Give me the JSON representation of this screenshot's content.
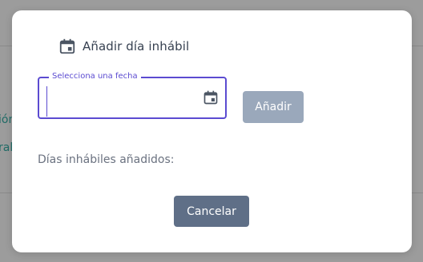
{
  "background": {
    "snippet_1": "ión",
    "snippet_2": "ral"
  },
  "dialog": {
    "title": "Añadir día inhábil",
    "title_icon": "calendar-icon",
    "date_field": {
      "label": "Selecciona una fecha",
      "value": "",
      "picker_icon": "calendar-icon"
    },
    "add_button_label": "Añadir",
    "added_days_label": "Días inhábiles añadidos:",
    "cancel_button_label": "Cancelar"
  },
  "colors": {
    "accent": "#5b4bd1",
    "add_button_disabled": "#9aa8bb",
    "cancel_button": "#5f6f87",
    "overlay": "#9c9c9c"
  }
}
